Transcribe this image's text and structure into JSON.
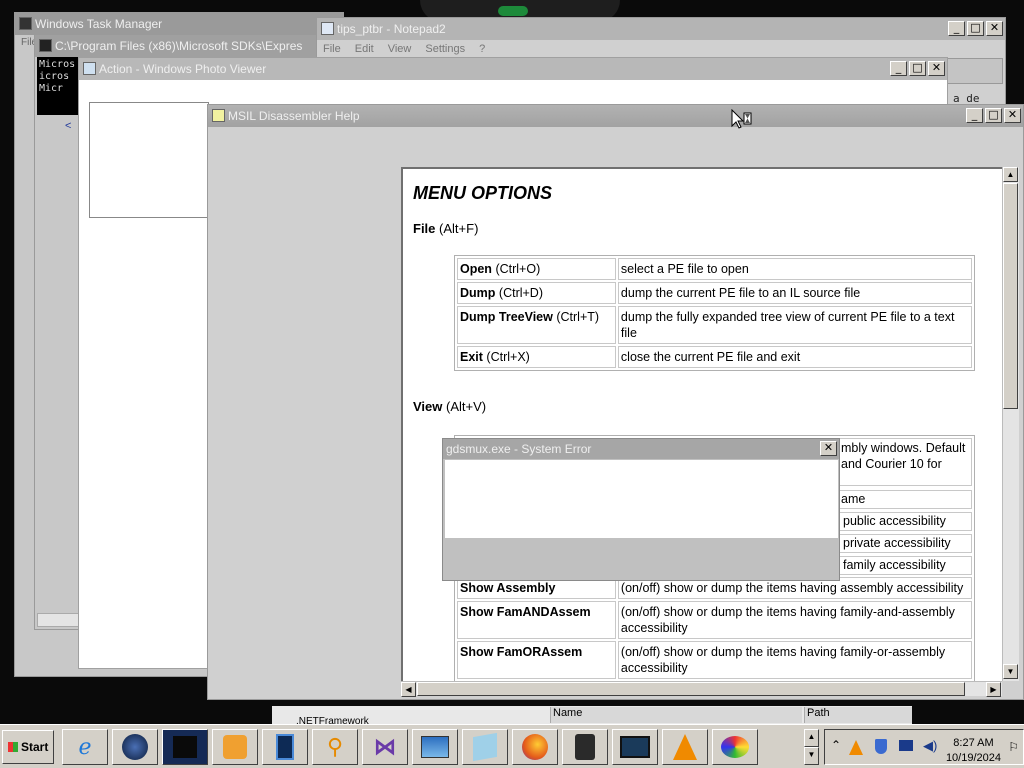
{
  "windows": {
    "task_manager": {
      "title": "Windows Task Manager",
      "menu_fragment": "File"
    },
    "cmd": {
      "title": "C:\\Program Files (x86)\\Microsoft SDKs\\Expres",
      "lines": [
        "Micros",
        "icros",
        "Micr"
      ]
    },
    "notepad": {
      "title": "tips_ptbr - Notepad2",
      "menu": [
        "File",
        "Edit",
        "View",
        "Settings",
        "?"
      ],
      "text_fragment": "a de tip"
    },
    "photo_viewer": {
      "title": "Action - Windows Photo Viewer"
    },
    "ildasm_help": {
      "title": "MSIL Disassembler Help"
    },
    "system_error": {
      "title": "gdsmux.exe - System Error",
      "close": "✕"
    }
  },
  "help": {
    "heading": "MENU OPTIONS",
    "file_section": {
      "name": "File",
      "shortcut": "(Alt+F)"
    },
    "file_options": [
      {
        "name": "Open",
        "shortcut": "(Ctrl+O)",
        "desc": "select a PE file to open"
      },
      {
        "name": "Dump",
        "shortcut": "(Ctrl+D)",
        "desc": "dump the current PE file to an IL source file"
      },
      {
        "name": "Dump TreeView",
        "shortcut": "(Ctrl+T)",
        "desc": "dump the fully expanded tree view of current PE file to a text file"
      },
      {
        "name": "Exit",
        "shortcut": "(Ctrl+X)",
        "desc": "close the current PE file and exit"
      }
    ],
    "view_section": {
      "name": "View",
      "shortcut": "(Alt+V)"
    },
    "view_partial": {
      "row1_line1": "mbly windows. Default",
      "row1_line2": "and Courier 10 for",
      "row2": "ame",
      "row3": "public accessibility",
      "row4": "private accessibility",
      "row5": "family accessibility"
    },
    "view_options": [
      {
        "name": "Show Assembly",
        "desc": "(on/off) show or dump the items having assembly accessibility"
      },
      {
        "name": "Show FamANDAssem",
        "desc": "(on/off) show or dump the items having family-and-assembly accessibility"
      },
      {
        "name": "Show FamORAssem",
        "desc": "(on/off) show or dump the items having family-or-assembly accessibility"
      }
    ]
  },
  "explorer_behind": {
    "col_name": "Name",
    "col_path": "Path",
    "item": ".NETFramework"
  },
  "taskbar": {
    "start_label": "Start",
    "buttons": [
      "ie-icon",
      "globe-icon",
      "terminal-icon",
      "media-player-icon",
      "tablet-icon",
      "search-icon",
      "visual-studio-icon",
      "photo-viewer-icon",
      "notepad-icon",
      "firefox-icon",
      "trash-icon",
      "monitor-icon",
      "vlc-icon",
      "paint-icon"
    ],
    "tray_icons": [
      "chevron-up-icon",
      "vlc-tray-icon",
      "shield-icon",
      "network-icon",
      "volume-icon"
    ],
    "time": "8:27 AM",
    "date": "10/19/2024"
  },
  "colors": {
    "desktop": "#000000",
    "titlebar_inactive": "#aaaaaa",
    "window_face": "#d4d0c8"
  }
}
